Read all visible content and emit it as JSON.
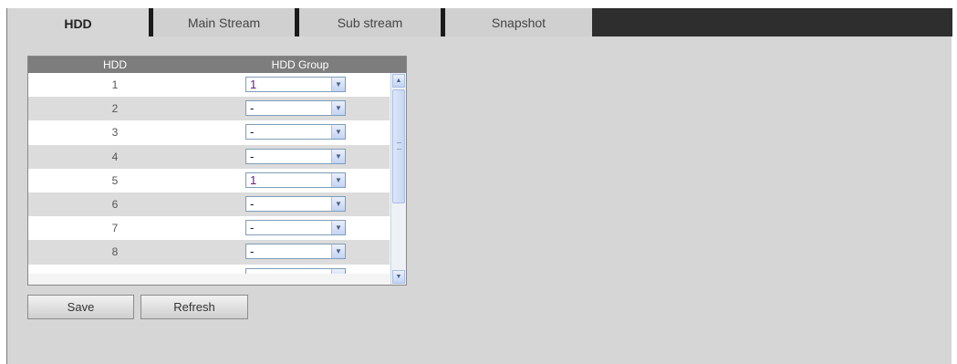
{
  "tabs": [
    {
      "label": "HDD",
      "active": true
    },
    {
      "label": "Main Stream",
      "active": false
    },
    {
      "label": "Sub stream",
      "active": false
    },
    {
      "label": "Snapshot",
      "active": false
    }
  ],
  "grid": {
    "headers": {
      "hdd": "HDD",
      "group": "HDD Group"
    },
    "rows": [
      {
        "hdd": "1",
        "group": "1"
      },
      {
        "hdd": "2",
        "group": "-"
      },
      {
        "hdd": "3",
        "group": "-"
      },
      {
        "hdd": "4",
        "group": "-"
      },
      {
        "hdd": "5",
        "group": "1"
      },
      {
        "hdd": "6",
        "group": "-"
      },
      {
        "hdd": "7",
        "group": "-"
      },
      {
        "hdd": "8",
        "group": "-"
      }
    ]
  },
  "buttons": {
    "save": "Save",
    "refresh": "Refresh"
  },
  "colors": {
    "tabbar": "#2e2e2e",
    "panel": "#d6d6d6",
    "header": "#7d7d7d",
    "group_selected": "#6b1e86"
  }
}
